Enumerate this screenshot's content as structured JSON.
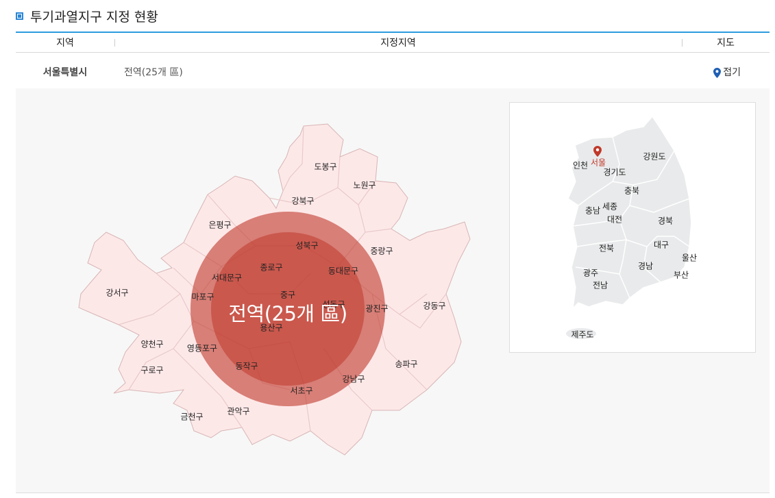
{
  "section_title": "투기과열지구 지정 현황",
  "table": {
    "headers": {
      "region": "지역",
      "designated": "지정지역",
      "map": "지도"
    },
    "row": {
      "region": "서울특별시",
      "designated": "전역(25개 區)",
      "map_button": "접기"
    }
  },
  "seoul_map": {
    "highlight_label": "전역(25개 區)",
    "districts": {
      "dobong": "도봉구",
      "nowon": "노원구",
      "gangbuk": "강북구",
      "eunpyeong": "은평구",
      "seongbuk": "성북구",
      "jungnang": "중랑구",
      "jongno": "종로구",
      "dongdaemun": "동대문구",
      "seodaemun": "서대문구",
      "gangseo": "강서구",
      "mapo": "마포구",
      "jung": "중구",
      "seongdong": "성동구",
      "gwangjin": "광진구",
      "gangdong": "강동구",
      "yongsan": "용산구",
      "yangcheon": "양천구",
      "yeongdeungpo": "영등포구",
      "guro": "구로구",
      "dongjak": "동작구",
      "gangnam": "강남구",
      "songpa": "송파구",
      "seocho": "서초구",
      "gwanak": "관악구",
      "geumcheon": "금천구"
    }
  },
  "korea_map": {
    "regions": {
      "incheon": "인천",
      "seoul": "서울",
      "gangwon": "강원도",
      "gyeonggi": "경기도",
      "chungbuk": "충북",
      "chungnam": "충남",
      "sejong": "세종",
      "daejeon": "대전",
      "gyeongbuk": "경북",
      "jeonbuk": "전북",
      "daegu": "대구",
      "ulsan": "울산",
      "gyeongnam": "경남",
      "gwangju": "광주",
      "busan": "부산",
      "jeonnam": "전남",
      "jeju": "제주도"
    },
    "selected": "seoul"
  },
  "colors": {
    "accent": "#2a9be0",
    "district_fill": "#fde8e8",
    "circle": "#c0392b",
    "pin_blue": "#1f5fb3"
  }
}
